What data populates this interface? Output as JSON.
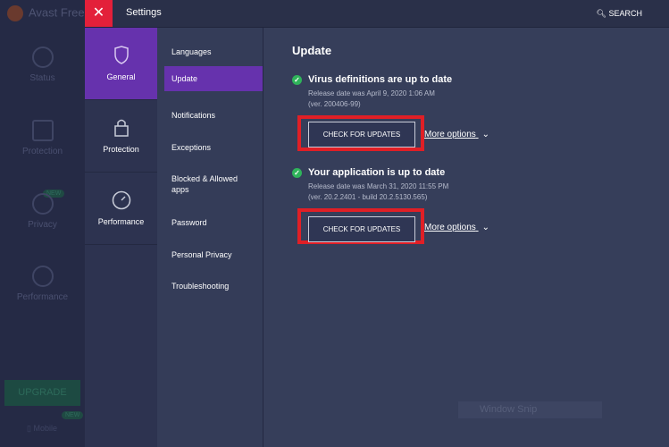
{
  "background_app": {
    "title": "Avast Free A",
    "nav": [
      "Status",
      "Protection",
      "Privacy",
      "Performance"
    ],
    "new_badge": "NEW",
    "upgrade": "UPGRADE",
    "mobile": "Mobile",
    "mobile_badge": "NEW"
  },
  "topbar": {
    "title": "Settings",
    "search": "SEARCH",
    "close": "✕"
  },
  "categories": [
    {
      "label": "General"
    },
    {
      "label": "Protection"
    },
    {
      "label": "Performance"
    }
  ],
  "submenu": [
    "Languages",
    "Update",
    "Notifications",
    "Exceptions",
    "Blocked & Allowed apps",
    "Password",
    "Personal Privacy",
    "Troubleshooting"
  ],
  "main": {
    "title": "Update",
    "sections": [
      {
        "heading": "Virus definitions are up to date",
        "line1": "Release date was April 9, 2020 1:06 AM",
        "line2": "(ver. 200406-99)",
        "button": "CHECK FOR UPDATES",
        "more": "More options"
      },
      {
        "heading": "Your application is up to date",
        "line1": "Release date was March 31, 2020 11:55 PM",
        "line2": "(ver. 20.2.2401 - build 20.2.5130.565)",
        "button": "CHECK FOR UPDATES",
        "more": "More options"
      }
    ]
  },
  "overlay": {
    "window_snip": "Window Snip"
  }
}
